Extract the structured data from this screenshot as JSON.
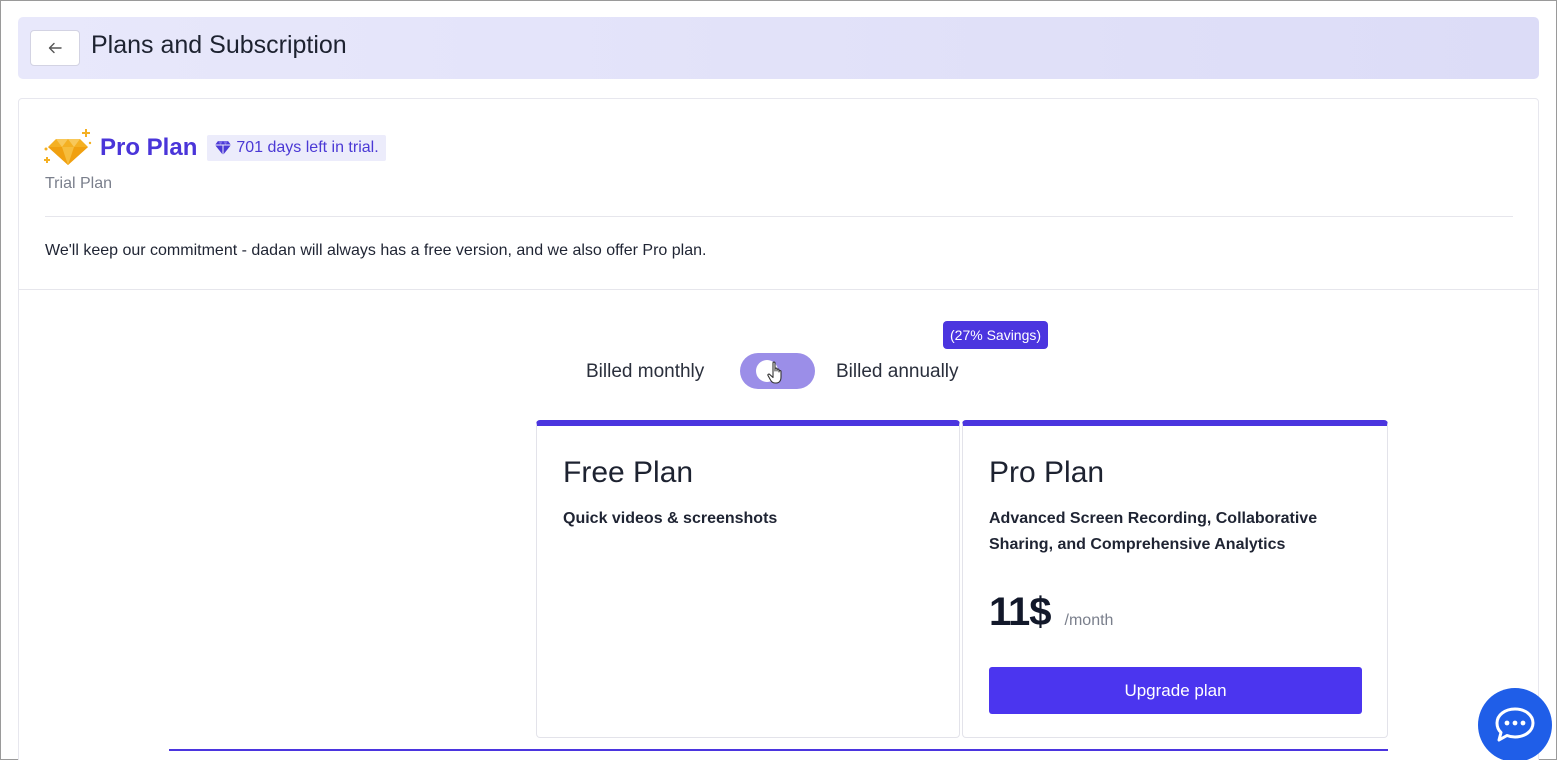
{
  "header": {
    "back_icon": "arrow-left-icon",
    "title": "Plans and Subscription"
  },
  "current_plan": {
    "icon": "diamond-sparkle-icon",
    "name": "Pro Plan",
    "trial_badge": "701 days left in trial.",
    "trial_badge_icon": "diamond-icon",
    "subtitle": "Trial Plan",
    "commitment": "We'll keep our commitment - dadan will always has a free version, and we also offer Pro plan."
  },
  "billing": {
    "savings_badge": "(27% Savings)",
    "monthly_label": "Billed monthly",
    "annually_label": "Billed annually"
  },
  "plans": [
    {
      "title": "Free Plan",
      "description": "Quick videos & screenshots"
    },
    {
      "title": "Pro Plan",
      "description": "Advanced Screen Recording, Collaborative Sharing, and Comprehensive Analytics",
      "price": "11$",
      "period": "/month",
      "cta": "Upgrade plan"
    }
  ],
  "chat": {
    "icon": "chat-bubble-icon"
  },
  "colors": {
    "accent": "#4b35df",
    "header_bg": "#e3e3f9",
    "toggle": "#9b8ee8",
    "gem": "#f4b023",
    "chat": "#1f5ee8"
  }
}
